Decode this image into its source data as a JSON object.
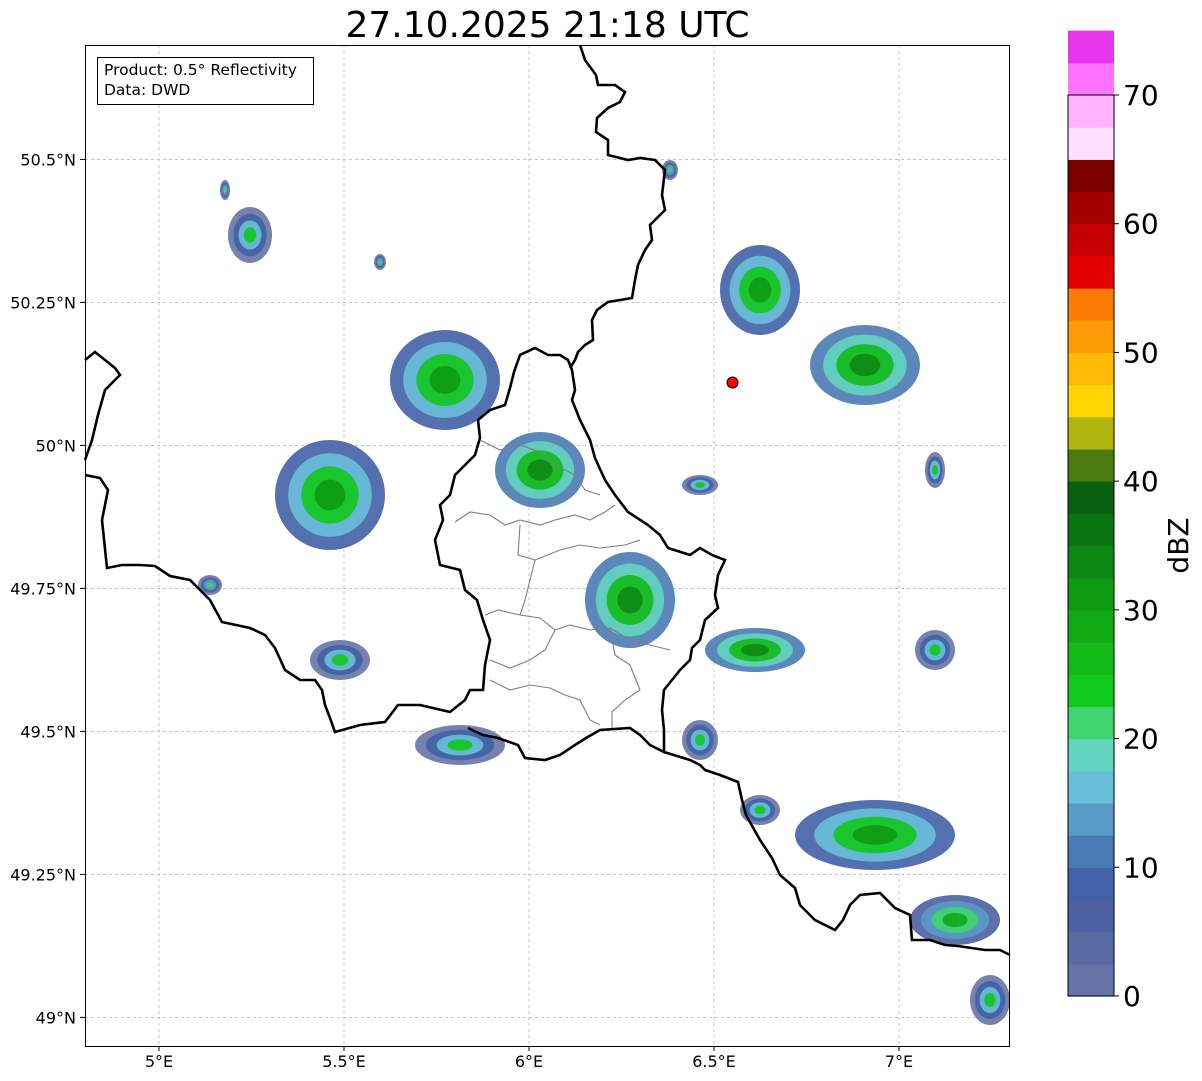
{
  "title": "27.10.2025 21:18 UTC",
  "info": {
    "product": "Product: 0.5° Reflectivity",
    "data": "Data: DWD"
  },
  "axes": {
    "lon_ticks": [
      "5°E",
      "5.5°E",
      "6°E",
      "6.5°E",
      "7°E"
    ],
    "lat_ticks": [
      "50.5°N",
      "50.25°N",
      "50°N",
      "49.75°N",
      "49.5°N",
      "49.25°N",
      "49°N"
    ],
    "lon_values": [
      5.0,
      5.5,
      6.0,
      6.5,
      7.0
    ],
    "lat_values": [
      50.5,
      50.25,
      50.0,
      49.75,
      49.5,
      49.25,
      49.0
    ],
    "lon_range": [
      4.8,
      7.3
    ],
    "lat_range": [
      48.95,
      50.7
    ],
    "grid": true
  },
  "colorbar": {
    "label": "dBZ",
    "tick_labels": [
      "0",
      "10",
      "20",
      "30",
      "40",
      "50",
      "60",
      "70"
    ],
    "range": [
      0,
      70
    ],
    "step": 2.5,
    "colors": [
      "#6673a6",
      "#5a6aa3",
      "#4c60a3",
      "#4361a6",
      "#4a7ab3",
      "#5a9ac6",
      "#69c0da",
      "#63d4c0",
      "#3fd46e",
      "#11c81c",
      "#13ba1a",
      "#11a916",
      "#0e9a12",
      "#0e8814",
      "#0b7412",
      "#0a6010",
      "#4a7a10",
      "#afb50f",
      "#fed503",
      "#ffba06",
      "#ff9c05",
      "#ff7c04",
      "#e40000",
      "#c60000",
      "#a40000",
      "#7b0000",
      "#ffddff",
      "#ffb3ff",
      "#ff73ff",
      "#e735ee"
    ]
  },
  "radar_site": {
    "lon": 6.55,
    "lat": 50.11,
    "color": "#ff0000"
  },
  "colors": {
    "border": "#000000",
    "admin": "#7f7f7f",
    "grid": "#b0b0b0"
  }
}
